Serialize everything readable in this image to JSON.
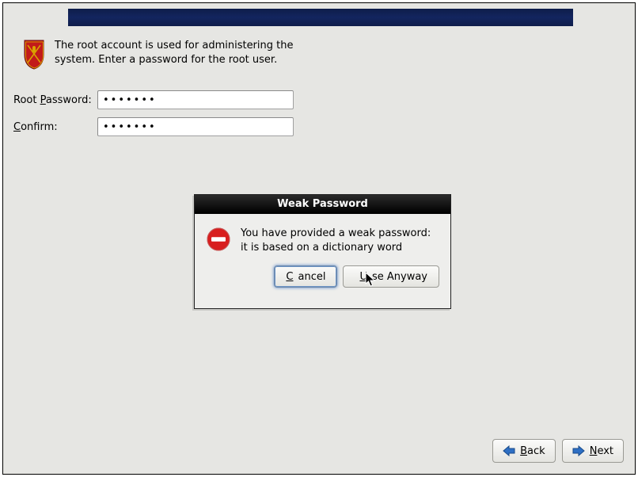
{
  "intro_text": "The root account is used for administering the system.  Enter a password for the root user.",
  "form": {
    "password_label_pre": "Root ",
    "password_label_u": "P",
    "password_label_post": "assword:",
    "confirm_label_u": "C",
    "confirm_label_post": "onfirm:",
    "password_value": "•••••••",
    "confirm_value": "•••••••"
  },
  "dialog": {
    "title": "Weak Password",
    "message": "You have provided a weak password: it is based on a dictionary word",
    "cancel_u": "C",
    "cancel_post": "ancel",
    "use_pre": "",
    "use_u": "U",
    "use_post": "se Anyway"
  },
  "nav": {
    "back_u": "B",
    "back_post": "ack",
    "next_u": "N",
    "next_post": "ext"
  }
}
